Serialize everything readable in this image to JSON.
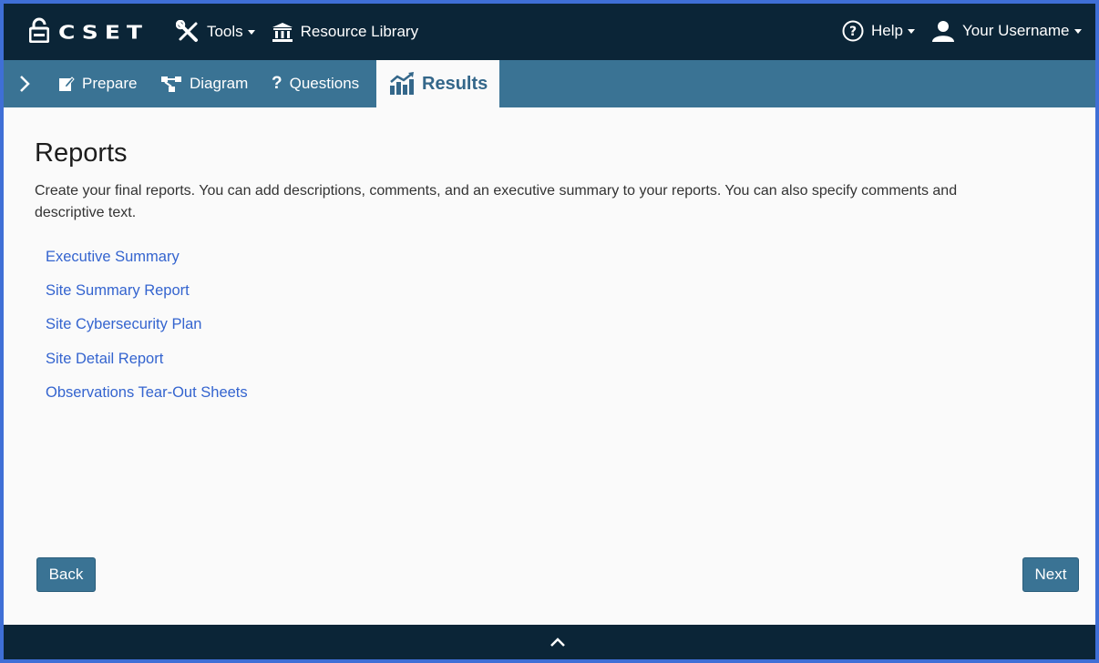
{
  "app": {
    "logo_text": "CSET"
  },
  "topnav": {
    "tools_label": "Tools",
    "resource_library_label": "Resource Library",
    "help_label": "Help",
    "username_label": "Your Username"
  },
  "tabs": {
    "prepare": "Prepare",
    "diagram": "Diagram",
    "questions": "Questions",
    "results": "Results"
  },
  "main": {
    "title": "Reports",
    "intro": "Create your final reports. You can add descriptions, comments, and an executive summary to your reports. You can also specify comments and descriptive text.",
    "reports": [
      "Executive Summary",
      "Site Summary Report",
      "Site Cybersecurity Plan",
      "Site Detail Report",
      "Observations Tear-Out Sheets"
    ]
  },
  "buttons": {
    "back": "Back",
    "next": "Next"
  },
  "colors": {
    "navbar": "#0b2537",
    "tabbar": "#3a7394",
    "link": "#3464cf",
    "frame": "#3f6fd6"
  },
  "icons": {
    "logo": "padlock-icon",
    "tools": "wrench-screwdriver-icon",
    "library": "bank-icon",
    "help": "question-circle-icon",
    "user": "user-icon",
    "sidebar": "chevron-right-icon",
    "prepare": "edit-icon",
    "diagram": "network-icon",
    "questions": "question-mark-icon",
    "results": "chart-trend-icon",
    "footer": "chevron-up-icon"
  }
}
